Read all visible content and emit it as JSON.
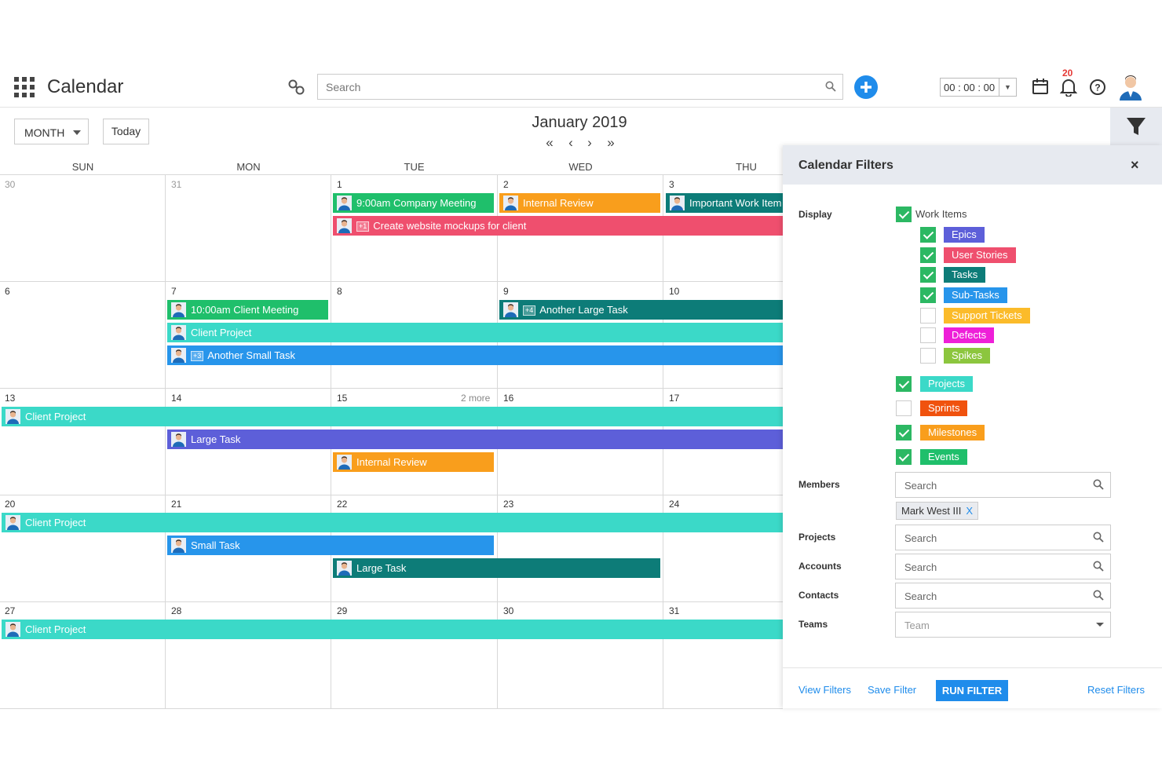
{
  "header": {
    "title": "Calendar",
    "search_placeholder": "Search",
    "timer": "00 : 00 : 00",
    "notification_count": "20"
  },
  "controls": {
    "view": "MONTH",
    "today_label": "Today",
    "month_title": "January 2019",
    "nav": {
      "prev_year": "«",
      "prev": "‹",
      "next": "›",
      "next_year": "»"
    }
  },
  "calendar": {
    "weekdays": [
      "SUN",
      "MON",
      "TUE",
      "WED",
      "THU"
    ],
    "weeks": [
      {
        "days": [
          "30",
          "31",
          "1",
          "2",
          "3"
        ]
      },
      {
        "days": [
          "6",
          "7",
          "8",
          "9",
          "10"
        ]
      },
      {
        "days": [
          "13",
          "14",
          "15",
          "16",
          "17"
        ],
        "more": "2 more"
      },
      {
        "days": [
          "20",
          "21",
          "22",
          "23",
          "24"
        ]
      },
      {
        "days": [
          "27",
          "28",
          "29",
          "30",
          "31"
        ]
      }
    ],
    "events": [
      {
        "title": "9:00am Company Meeting",
        "color": "#1fbf6b"
      },
      {
        "title": "Internal Review",
        "color": "#f99e1c"
      },
      {
        "title": "Important Work Item",
        "color": "#0d7c78"
      },
      {
        "title": "Create website mockups for client",
        "color": "#ef4f6e",
        "badge": "+1"
      },
      {
        "title": "10:00am Client Meeting",
        "color": "#1fbf6b"
      },
      {
        "title": "Another Large Task",
        "color": "#0d7c78",
        "badge": "+4"
      },
      {
        "title": "Client Project",
        "color": "#3bd9c8"
      },
      {
        "title": "Another Small Task",
        "color": "#2795eb",
        "badge": "+3"
      },
      {
        "title": "Client Project",
        "color": "#3bd9c8"
      },
      {
        "title": "Large Task",
        "color": "#5d5fd9"
      },
      {
        "title": "Internal Review",
        "color": "#f99e1c"
      },
      {
        "title": "Client Project",
        "color": "#3bd9c8"
      },
      {
        "title": "Small Task",
        "color": "#2795eb"
      },
      {
        "title": "Large Task",
        "color": "#0d7c78"
      },
      {
        "title": "Client Project",
        "color": "#3bd9c8"
      }
    ]
  },
  "filters": {
    "title": "Calendar Filters",
    "close": "×",
    "display_label": "Display",
    "work_items": {
      "label": "Work Items",
      "checked": true
    },
    "sub_items": [
      {
        "label": "Epics",
        "color": "#5d5fd9",
        "checked": true
      },
      {
        "label": "User Stories",
        "color": "#ef4f6e",
        "checked": true
      },
      {
        "label": "Tasks",
        "color": "#0d7c78",
        "checked": true
      },
      {
        "label": "Sub-Tasks",
        "color": "#2795eb",
        "checked": true
      },
      {
        "label": "Support Tickets",
        "color": "#fbbb2a",
        "checked": false
      },
      {
        "label": "Defects",
        "color": "#ee1fd8",
        "checked": false
      },
      {
        "label": "Spikes",
        "color": "#8cc63e",
        "checked": false
      }
    ],
    "top_items": [
      {
        "label": "Projects",
        "color": "#3bd9c8",
        "checked": true
      },
      {
        "label": "Sprints",
        "color": "#f0520e",
        "checked": false
      },
      {
        "label": "Milestones",
        "color": "#f99e1c",
        "checked": true
      },
      {
        "label": "Events",
        "color": "#1fbf6b",
        "checked": true
      }
    ],
    "members_label": "Members",
    "members_placeholder": "Search",
    "member_chip": "Mark West III",
    "member_chip_remove": "X",
    "projects_label": "Projects",
    "projects_placeholder": "Search",
    "accounts_label": "Accounts",
    "accounts_placeholder": "Search",
    "contacts_label": "Contacts",
    "contacts_placeholder": "Search",
    "teams_label": "Teams",
    "teams_placeholder": "Team",
    "view_filters": "View Filters",
    "save_filter": "Save Filter",
    "run_filter": "RUN FILTER",
    "reset_filters": "Reset Filters"
  }
}
